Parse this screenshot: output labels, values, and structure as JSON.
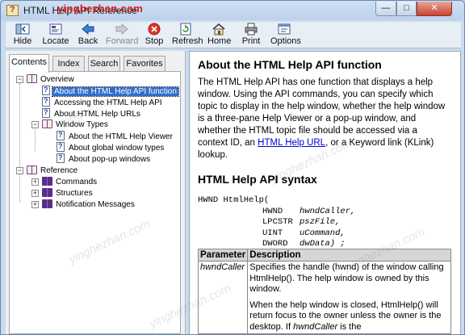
{
  "window": {
    "title": "HTML Help API Reference"
  },
  "watermark": {
    "top": "yinghezhan.com",
    "faint": "yinghezhan.com"
  },
  "title_controls": {
    "minimize": "—",
    "maximize": "□",
    "close": "✕"
  },
  "toolbar": {
    "hide": "Hide",
    "locate": "Locate",
    "back": "Back",
    "forward": "Forward",
    "stop": "Stop",
    "refresh": "Refresh",
    "home": "Home",
    "print": "Print",
    "options": "Options"
  },
  "tabs": {
    "contents": "Contents",
    "index": "Index",
    "search": "Search",
    "favorites": "Favorites"
  },
  "tree": {
    "overview": "Overview",
    "about_function": "About the HTML Help API function",
    "accessing": "Accessing the HTML Help API",
    "about_urls": "About HTML Help URLs",
    "window_types": "Window Types",
    "about_viewer": "About the HTML Help Viewer",
    "about_global": "About global window types",
    "about_popup": "About pop-up windows",
    "reference": "Reference",
    "commands": "Commands",
    "structures": "Structures",
    "notifications": "Notification Messages"
  },
  "article": {
    "heading": "About the HTML Help API function",
    "intro_before_link": "The HTML Help API has one function that displays a help window. Using the API commands, you can specify which topic to display in the help window, whether the help window is a three-pane Help Viewer or a pop-up window, and whether the HTML topic file should be accessed via a context ID, an ",
    "link": "HTML Help URL",
    "intro_after_link": ", or a Keyword link (KLink) lookup.",
    "syntax_heading": "HTML Help API syntax",
    "code_fn": "HWND HtmlHelp(",
    "code_l1_type": "HWND",
    "code_l1_arg": "hwndCaller,",
    "code_l2_type": "LPCSTR",
    "code_l2_arg": "pszFile,",
    "code_l3_type": "UINT",
    "code_l3_arg": "uCommand,",
    "code_l4_type": "DWORD",
    "code_l4_arg": "dwData) ;",
    "table": {
      "col_param": "Parameter",
      "col_desc": "Description",
      "p1_name": "hwndCaller",
      "p1_desc1": "Specifies the handle (hwnd) of the window calling HtmlHelp(). The help window is owned by this window.",
      "p1_desc2_before": "When the help window is closed, HtmlHelp() will return focus to the owner unless the owner is the desktop. If ",
      "p1_desc2_italic": "hwndCaller",
      "p1_desc2_after": " is the"
    }
  },
  "colors": {
    "selection": "#2f6fcc",
    "link": "#0000cc",
    "watermark": "#d11d1d",
    "close_button": "#c7442c"
  }
}
